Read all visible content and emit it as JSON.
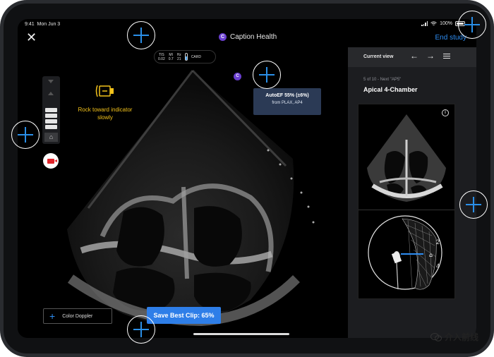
{
  "status_bar": {
    "time": "9:41",
    "date": "Mon Jun 3",
    "battery": "100%"
  },
  "header": {
    "close_icon": "close-icon",
    "brand_logo_letter": "C",
    "brand_name": "Caption Health",
    "end_study_label": "End study",
    "accent_color": "#2e8df2"
  },
  "metrics": {
    "tis_label": "TIS",
    "tis_value": "0.02",
    "mi_label": "MI",
    "mi_value": "0.7",
    "hz_label": "Hz",
    "hz_value": "21",
    "preset": "CARD"
  },
  "scan": {
    "depth_home_icon": "home-icon",
    "record_icon": "video-camera-icon",
    "guidance": "Rock toward indicator slowly",
    "guidance_color": "#f3c21b",
    "badge_letter": "C",
    "autoef_value": "AutoEF 55% (±6%)",
    "autoef_source": "from PLAX, AP4",
    "color_doppler_label": "Color Doppler",
    "save_clip_label": "Save Best Clip: 65%"
  },
  "panel": {
    "current_view_label": "Current view",
    "step_text": "5 of 10 - Next \"AP5\"",
    "view_name": "Apical 4-Chamber",
    "diagram_label_top": "2",
    "diagram_label_bottom": "4"
  },
  "watermark": "介入前线"
}
